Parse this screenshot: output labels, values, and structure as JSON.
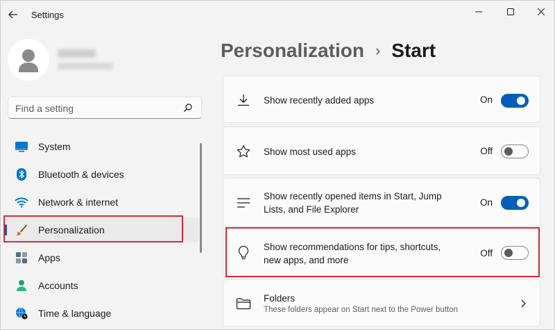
{
  "window": {
    "title": "Settings"
  },
  "sidebar": {
    "search_placeholder": "Find a setting",
    "items": [
      {
        "label": "System",
        "icon": "monitor-icon"
      },
      {
        "label": "Bluetooth & devices",
        "icon": "bluetooth-icon"
      },
      {
        "label": "Network & internet",
        "icon": "wifi-icon"
      },
      {
        "label": "Personalization",
        "icon": "brush-icon",
        "active": true
      },
      {
        "label": "Apps",
        "icon": "apps-icon"
      },
      {
        "label": "Accounts",
        "icon": "person-icon"
      },
      {
        "label": "Time & language",
        "icon": "globe-clock-icon"
      }
    ]
  },
  "main": {
    "breadcrumb_parent": "Personalization",
    "breadcrumb_sep": "›",
    "breadcrumb_current": "Start",
    "cards": [
      {
        "label": "Show recently added apps",
        "state": "On",
        "icon": "download-icon"
      },
      {
        "label": "Show most used apps",
        "state": "Off",
        "icon": "star-icon"
      },
      {
        "label": "Show recently opened items in Start, Jump Lists, and File Explorer",
        "state": "On",
        "icon": "list-icon"
      },
      {
        "label": "Show recommendations for tips, shortcuts, new apps, and more",
        "state": "Off",
        "icon": "lightbulb-icon"
      },
      {
        "label": "Folders",
        "sublabel": "These folders appear on Start next to the Power button",
        "icon": "folder-icon"
      }
    ]
  },
  "colors": {
    "accent": "#005fb8",
    "highlight": "#d62a35",
    "background": "#f3f3f3",
    "card": "#fbfbfb"
  }
}
